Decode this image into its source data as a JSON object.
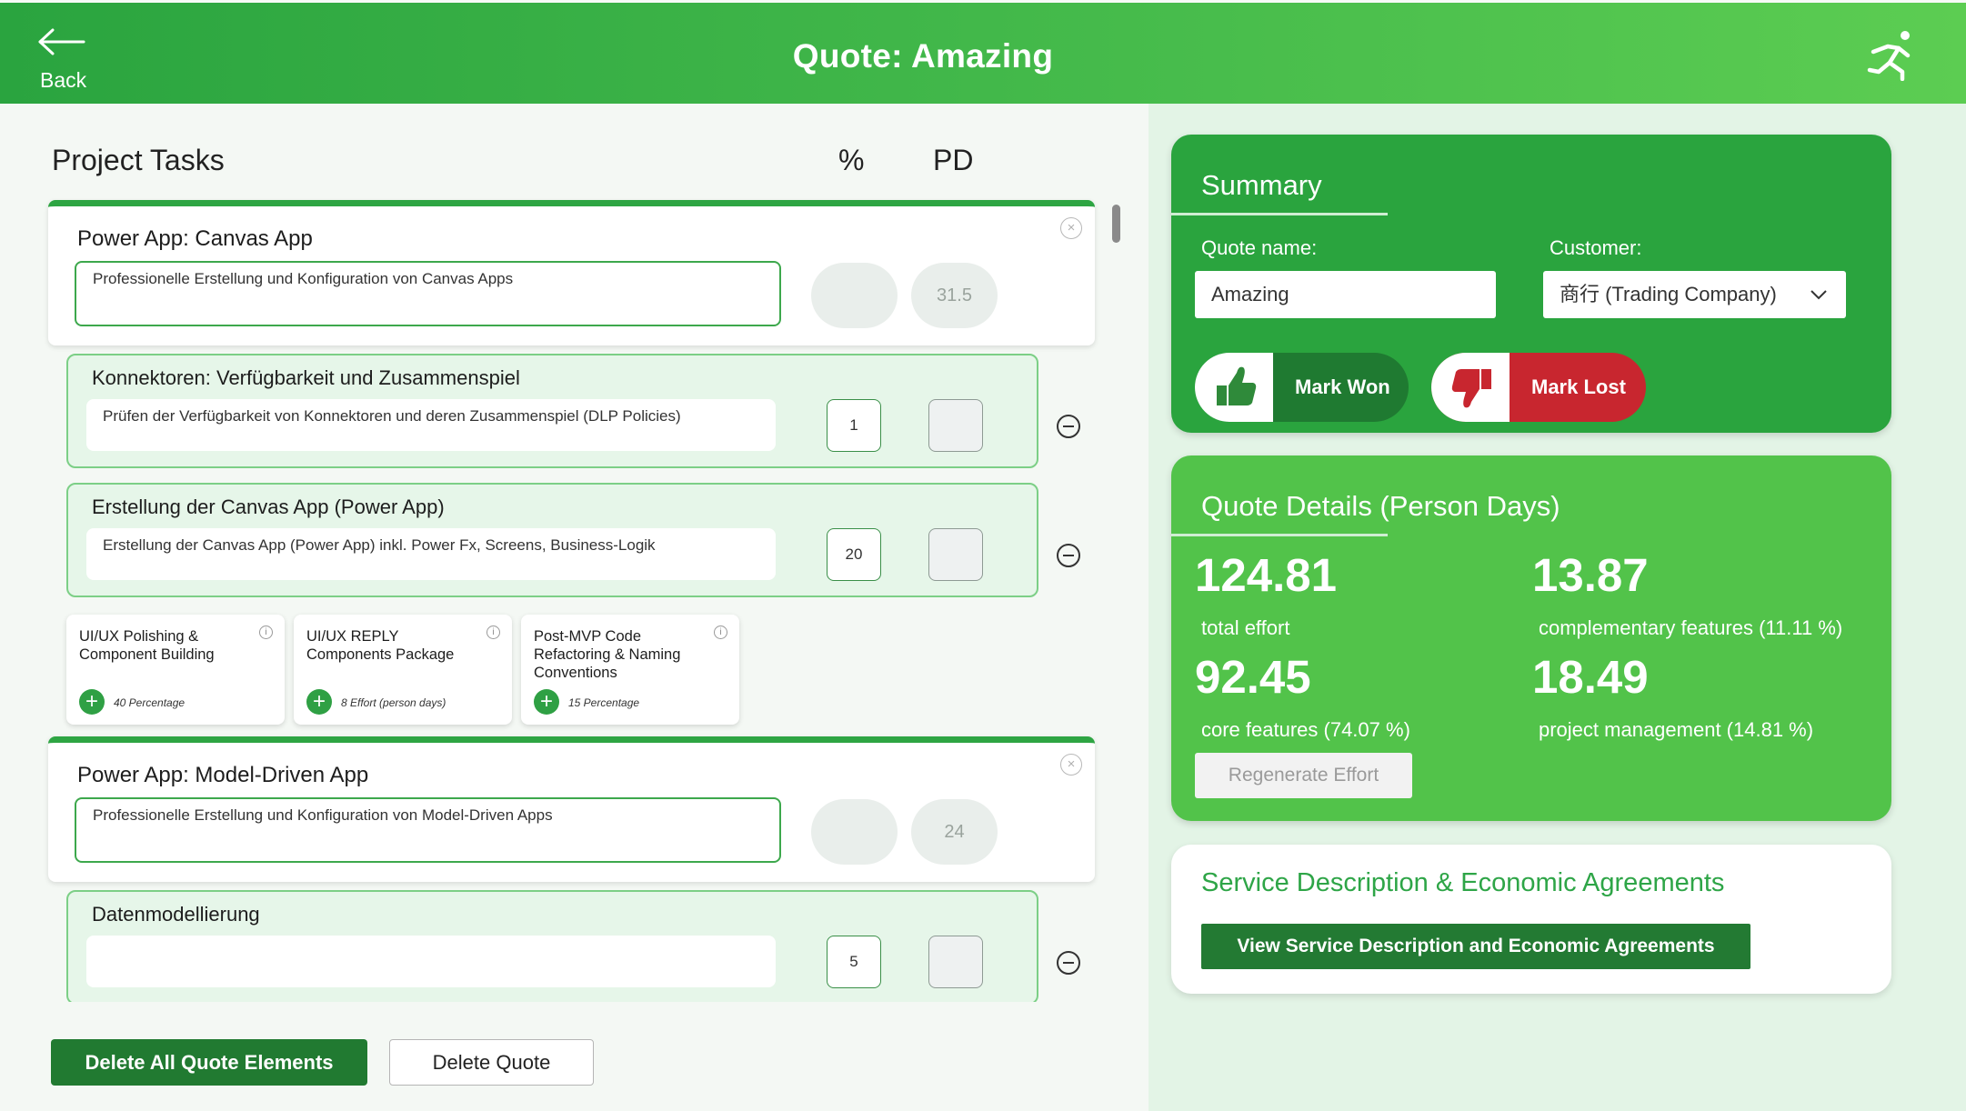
{
  "header": {
    "back_label": "Back",
    "title": "Quote: Amazing",
    "brand_icon": "running-figure-icon"
  },
  "tasks": {
    "title": "Project Tasks",
    "col_pct": "%",
    "col_pd": "PD",
    "groups": [
      {
        "title": "Power App: Canvas App",
        "description": "Professionelle Erstellung und Konfiguration von Canvas Apps",
        "pct": "",
        "pd": "31.5",
        "children": [
          {
            "title": "Konnektoren: Verfügbarkeit und Zusammenspiel",
            "description": "Prüfen der Verfügbarkeit von Konnektoren und deren Zusammenspiel (DLP Policies)",
            "pct": "1",
            "pd": ""
          },
          {
            "title": "Erstellung der Canvas App (Power App)",
            "description": "Erstellung der Canvas App (Power App) inkl. Power Fx, Screens, Business-Logik",
            "pct": "20",
            "pd": ""
          }
        ],
        "suggestions": [
          {
            "title": "UI/UX Polishing & Component Building",
            "label": "40 Percentage"
          },
          {
            "title": "UI/UX REPLY Components Package",
            "label": "8 Effort (person days)"
          },
          {
            "title": "Post-MVP Code Refactoring & Naming Conventions",
            "label": "15 Percentage"
          }
        ]
      },
      {
        "title": "Power App: Model-Driven App",
        "description": "Professionelle Erstellung und Konfiguration von Model-Driven Apps",
        "pct": "",
        "pd": "24",
        "children": [
          {
            "title": "Datenmodellierung",
            "description": "",
            "pct": "5",
            "pd": ""
          }
        ]
      }
    ]
  },
  "actions": {
    "delete_all": "Delete All Quote Elements",
    "delete_quote": "Delete Quote"
  },
  "summary": {
    "title": "Summary",
    "quote_name_label": "Quote name:",
    "quote_name_value": "Amazing",
    "customer_label": "Customer:",
    "customer_value": "商行 (Trading Company)",
    "mark_won": "Mark Won",
    "mark_lost": "Mark Lost"
  },
  "details": {
    "title": "Quote Details (Person Days)",
    "total_effort_value": "124.81",
    "total_effort_label": "total effort",
    "complementary_value": "13.87",
    "complementary_label": "complementary features (11.11 %)",
    "core_value": "92.45",
    "core_label": "core features (74.07 %)",
    "pm_value": "18.49",
    "pm_label": "project management (14.81 %)",
    "regenerate": "Regenerate Effort"
  },
  "service": {
    "title": "Service Description & Economic Agreements",
    "button": "View Service Description and Economic Agreements"
  },
  "colors": {
    "header_gradient_start": "#2aa43f",
    "header_gradient_end": "#5ccd52",
    "summary_bg": "#2aa43e",
    "details_bg": "#52c34a",
    "won": "#1f7a31",
    "lost": "#c8262f",
    "primary_button": "#217a31"
  }
}
